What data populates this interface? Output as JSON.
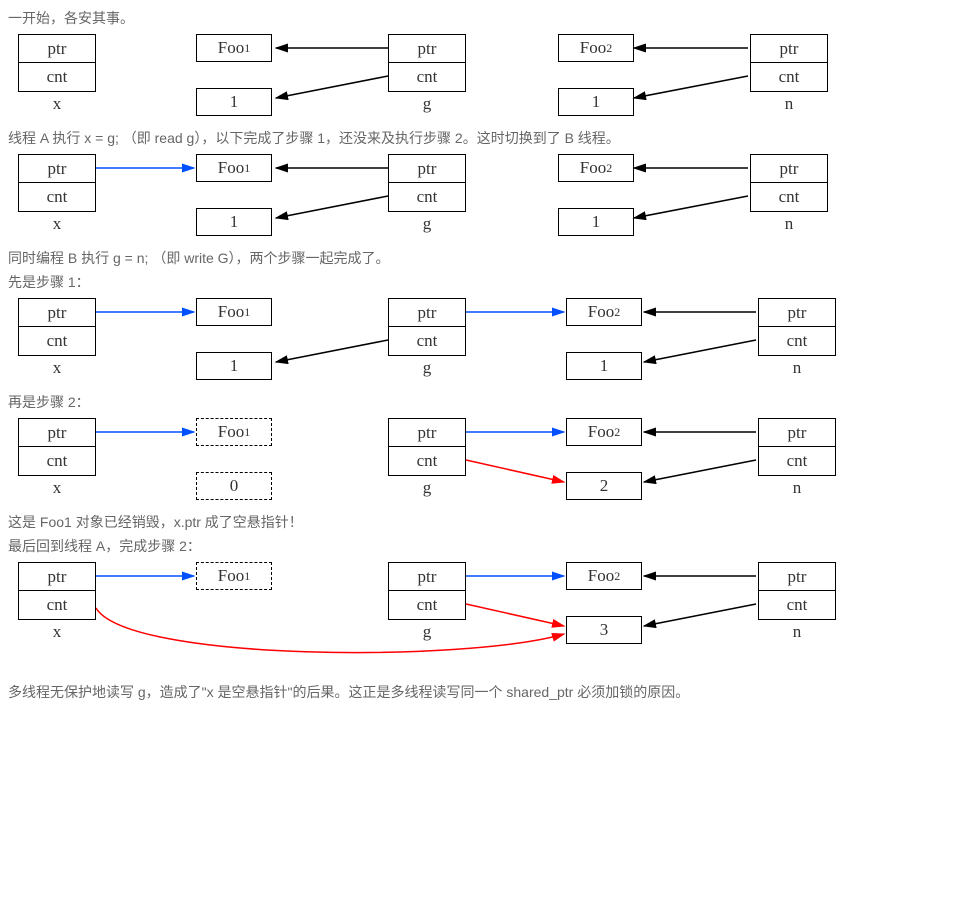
{
  "texts": {
    "t1": "一开始，各安其事。",
    "t2": "线程 A 执行 x = g; （即 read g），以下完成了步骤 1，还没来及执行步骤 2。这时切换到了 B 线程。",
    "t3": "同时编程 B 执行 g = n; （即 write G），两个步骤一起完成了。",
    "t4": "先是步骤 1：",
    "t5": "再是步骤 2：",
    "t6": "这是 Foo1 对象已经销毁，x.ptr 成了空悬指针！",
    "t7": "最后回到线程 A，完成步骤 2：",
    "t8": "多线程无保护地读写 g，造成了\"x 是空悬指针\"的后果。这正是多线程读写同一个 shared_ptr 必须加锁的原因。"
  },
  "labels": {
    "ptr": "ptr",
    "cnt": "cnt",
    "x": "x",
    "g": "g",
    "n": "n",
    "foo1": "Foo ",
    "foo1sub": "1",
    "foo2": "Foo ",
    "foo2sub": "2",
    "one": "1",
    "two": "2",
    "three": "3",
    "zero": "0"
  }
}
